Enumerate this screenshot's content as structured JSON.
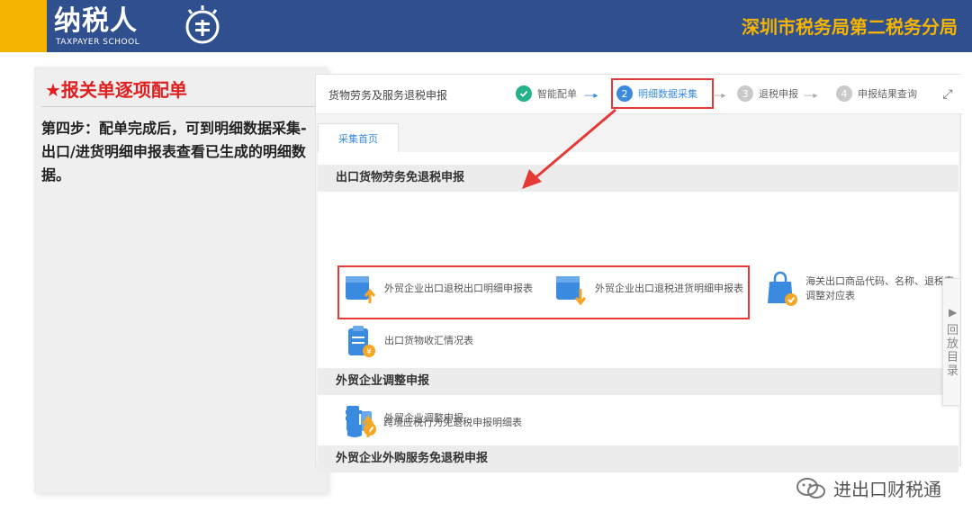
{
  "header": {
    "logo_text": "纳税人",
    "logo_sub": "TAXPAYER SCHOOL",
    "bureau": "深圳市税务局第二税务分局"
  },
  "left_panel": {
    "title": "★报关单逐项配单",
    "body": "第四步：配单完成后，可到明细数据采集-出口/进货明细申报表查看已生成的明细数据。"
  },
  "topbar": {
    "crumb": "货物劳务及服务退税申报",
    "steps": [
      {
        "num": "",
        "label": "智能配单",
        "state": "done"
      },
      {
        "num": "2",
        "label": "明细数据采集",
        "state": "active"
      },
      {
        "num": "3",
        "label": "退税申报",
        "state": "todo"
      },
      {
        "num": "4",
        "label": "申报结果查询",
        "state": "todo"
      }
    ]
  },
  "tab": {
    "label": "采集首页"
  },
  "sections": [
    {
      "title": "出口货物劳务免退税申报",
      "items": [
        {
          "label": "外贸企业出口退税出口明细申报表",
          "icon": "export-detail-icon"
        },
        {
          "label": "外贸企业出口退税进货明细申报表",
          "icon": "purchase-detail-icon"
        },
        {
          "label": "海关出口商品代码、名称、退税率调整对应表",
          "icon": "customs-code-icon"
        },
        {
          "label": "出口货物收汇情况表",
          "icon": "remittance-icon"
        }
      ]
    },
    {
      "title": "外贸企业调整申报",
      "items": [
        {
          "label": "外贸企业调整申报",
          "icon": "adjust-icon"
        }
      ]
    },
    {
      "title": "外贸企业外购服务免退税申报",
      "items": [
        {
          "label": "跨境应税行为免退税申报明细表",
          "icon": "cross-border-icon"
        }
      ]
    }
  ],
  "side_tab": {
    "label": "回放目录"
  },
  "wechat": {
    "label": "进出口财税通"
  },
  "colors": {
    "header_bg": "#2f4f8f",
    "accent_yellow": "#f5b400",
    "highlight_red": "#e53935",
    "step_done": "#23b28a",
    "step_active": "#3a8be0"
  }
}
